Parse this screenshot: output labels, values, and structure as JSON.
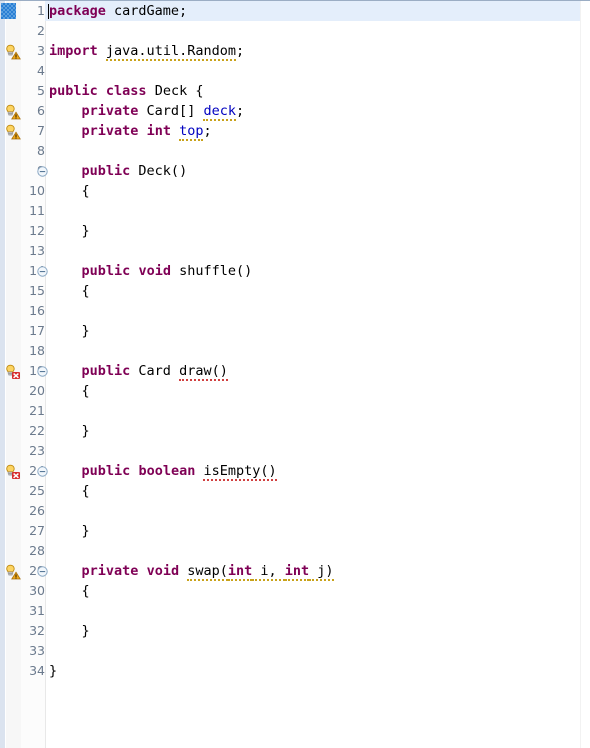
{
  "editor": {
    "app": "eclipse-java-editor",
    "language": "java",
    "colors": {
      "keyword": "#7f0055",
      "field": "#0000c0",
      "plain": "#000000",
      "current_line_highlight": "#e4eefb",
      "line_number": "#6b7a8d",
      "error_squiggle": "#d04040",
      "warning_squiggle": "#c8a21a",
      "gutter_background": "#f7f7f7"
    },
    "cursor": {
      "line": 1,
      "column": 1
    },
    "total_lines": 34,
    "lines": [
      {
        "number": "1",
        "current": true,
        "marker": "current-line",
        "fold": null,
        "tokens": [
          {
            "text": "package",
            "type": "kw"
          },
          {
            "text": " cardGame;",
            "type": "plain"
          }
        ]
      },
      {
        "number": "2",
        "current": false,
        "marker": null,
        "fold": null,
        "tokens": []
      },
      {
        "number": "3",
        "current": false,
        "marker": "warning",
        "fold": null,
        "tokens": [
          {
            "text": "import",
            "type": "kw"
          },
          {
            "text": " ",
            "type": "plain"
          },
          {
            "text": "java.util.Random",
            "type": "plain",
            "squiggle": "warning"
          },
          {
            "text": ";",
            "type": "plain"
          }
        ]
      },
      {
        "number": "4",
        "current": false,
        "marker": null,
        "fold": null,
        "tokens": []
      },
      {
        "number": "5",
        "current": false,
        "marker": null,
        "fold": null,
        "tokens": [
          {
            "text": "public",
            "type": "kw"
          },
          {
            "text": " ",
            "type": "plain"
          },
          {
            "text": "class",
            "type": "kw"
          },
          {
            "text": " Deck {",
            "type": "plain"
          }
        ]
      },
      {
        "number": "6",
        "current": false,
        "marker": "warning",
        "fold": null,
        "tokens": [
          {
            "text": "    ",
            "type": "plain"
          },
          {
            "text": "private",
            "type": "kw"
          },
          {
            "text": " Card[] ",
            "type": "plain"
          },
          {
            "text": "deck",
            "type": "fld",
            "squiggle": "warning"
          },
          {
            "text": ";",
            "type": "plain"
          }
        ]
      },
      {
        "number": "7",
        "current": false,
        "marker": "warning",
        "fold": null,
        "tokens": [
          {
            "text": "    ",
            "type": "plain"
          },
          {
            "text": "private",
            "type": "kw"
          },
          {
            "text": " ",
            "type": "plain"
          },
          {
            "text": "int",
            "type": "kw"
          },
          {
            "text": " ",
            "type": "plain"
          },
          {
            "text": "top",
            "type": "fld",
            "squiggle": "warning"
          },
          {
            "text": ";",
            "type": "plain"
          }
        ]
      },
      {
        "number": "8",
        "current": false,
        "marker": null,
        "fold": null,
        "tokens": []
      },
      {
        "number": "9",
        "current": false,
        "marker": null,
        "fold": "collapse",
        "tokens": [
          {
            "text": "    ",
            "type": "plain"
          },
          {
            "text": "public",
            "type": "kw"
          },
          {
            "text": " Deck()",
            "type": "plain"
          }
        ]
      },
      {
        "number": "10",
        "current": false,
        "marker": null,
        "fold": null,
        "tokens": [
          {
            "text": "    {",
            "type": "plain"
          }
        ]
      },
      {
        "number": "11",
        "current": false,
        "marker": null,
        "fold": null,
        "tokens": []
      },
      {
        "number": "12",
        "current": false,
        "marker": null,
        "fold": null,
        "tokens": [
          {
            "text": "    }",
            "type": "plain"
          }
        ]
      },
      {
        "number": "13",
        "current": false,
        "marker": null,
        "fold": null,
        "tokens": []
      },
      {
        "number": "14",
        "current": false,
        "marker": null,
        "fold": "collapse",
        "tokens": [
          {
            "text": "    ",
            "type": "plain"
          },
          {
            "text": "public",
            "type": "kw"
          },
          {
            "text": " ",
            "type": "plain"
          },
          {
            "text": "void",
            "type": "kw"
          },
          {
            "text": " shuffle()",
            "type": "plain"
          }
        ]
      },
      {
        "number": "15",
        "current": false,
        "marker": null,
        "fold": null,
        "tokens": [
          {
            "text": "    {",
            "type": "plain"
          }
        ]
      },
      {
        "number": "16",
        "current": false,
        "marker": null,
        "fold": null,
        "tokens": []
      },
      {
        "number": "17",
        "current": false,
        "marker": null,
        "fold": null,
        "tokens": [
          {
            "text": "    }",
            "type": "plain"
          }
        ]
      },
      {
        "number": "18",
        "current": false,
        "marker": null,
        "fold": null,
        "tokens": []
      },
      {
        "number": "19",
        "current": false,
        "marker": "error",
        "fold": "collapse",
        "tokens": [
          {
            "text": "    ",
            "type": "plain"
          },
          {
            "text": "public",
            "type": "kw"
          },
          {
            "text": " Card ",
            "type": "plain"
          },
          {
            "text": "draw()",
            "type": "plain",
            "squiggle": "error"
          }
        ]
      },
      {
        "number": "20",
        "current": false,
        "marker": null,
        "fold": null,
        "tokens": [
          {
            "text": "    {",
            "type": "plain"
          }
        ]
      },
      {
        "number": "21",
        "current": false,
        "marker": null,
        "fold": null,
        "tokens": []
      },
      {
        "number": "22",
        "current": false,
        "marker": null,
        "fold": null,
        "tokens": [
          {
            "text": "    }",
            "type": "plain"
          }
        ]
      },
      {
        "number": "23",
        "current": false,
        "marker": null,
        "fold": null,
        "tokens": []
      },
      {
        "number": "24",
        "current": false,
        "marker": "error",
        "fold": "collapse",
        "tokens": [
          {
            "text": "    ",
            "type": "plain"
          },
          {
            "text": "public",
            "type": "kw"
          },
          {
            "text": " ",
            "type": "plain"
          },
          {
            "text": "boolean",
            "type": "kw"
          },
          {
            "text": " ",
            "type": "plain"
          },
          {
            "text": "isEmpty()",
            "type": "plain",
            "squiggle": "error"
          }
        ]
      },
      {
        "number": "25",
        "current": false,
        "marker": null,
        "fold": null,
        "tokens": [
          {
            "text": "    {",
            "type": "plain"
          }
        ]
      },
      {
        "number": "26",
        "current": false,
        "marker": null,
        "fold": null,
        "tokens": []
      },
      {
        "number": "27",
        "current": false,
        "marker": null,
        "fold": null,
        "tokens": [
          {
            "text": "    }",
            "type": "plain"
          }
        ]
      },
      {
        "number": "28",
        "current": false,
        "marker": null,
        "fold": null,
        "tokens": []
      },
      {
        "number": "29",
        "current": false,
        "marker": "warning",
        "fold": "collapse",
        "tokens": [
          {
            "text": "    ",
            "type": "plain"
          },
          {
            "text": "private",
            "type": "kw"
          },
          {
            "text": " ",
            "type": "plain"
          },
          {
            "text": "void",
            "type": "kw"
          },
          {
            "text": " ",
            "type": "plain"
          },
          {
            "text": "swap(",
            "type": "plain",
            "squiggle": "warning"
          },
          {
            "text": "int",
            "type": "kw",
            "squiggle": "warning"
          },
          {
            "text": " i, ",
            "type": "plain",
            "squiggle": "warning"
          },
          {
            "text": "int",
            "type": "kw",
            "squiggle": "warning"
          },
          {
            "text": " j)",
            "type": "plain",
            "squiggle": "warning"
          }
        ]
      },
      {
        "number": "30",
        "current": false,
        "marker": null,
        "fold": null,
        "tokens": [
          {
            "text": "    {",
            "type": "plain"
          }
        ]
      },
      {
        "number": "31",
        "current": false,
        "marker": null,
        "fold": null,
        "tokens": []
      },
      {
        "number": "32",
        "current": false,
        "marker": null,
        "fold": null,
        "tokens": [
          {
            "text": "    }",
            "type": "plain"
          }
        ]
      },
      {
        "number": "33",
        "current": false,
        "marker": null,
        "fold": null,
        "tokens": []
      },
      {
        "number": "34",
        "current": false,
        "marker": null,
        "fold": null,
        "tokens": [
          {
            "text": "}",
            "type": "plain"
          }
        ]
      }
    ]
  }
}
